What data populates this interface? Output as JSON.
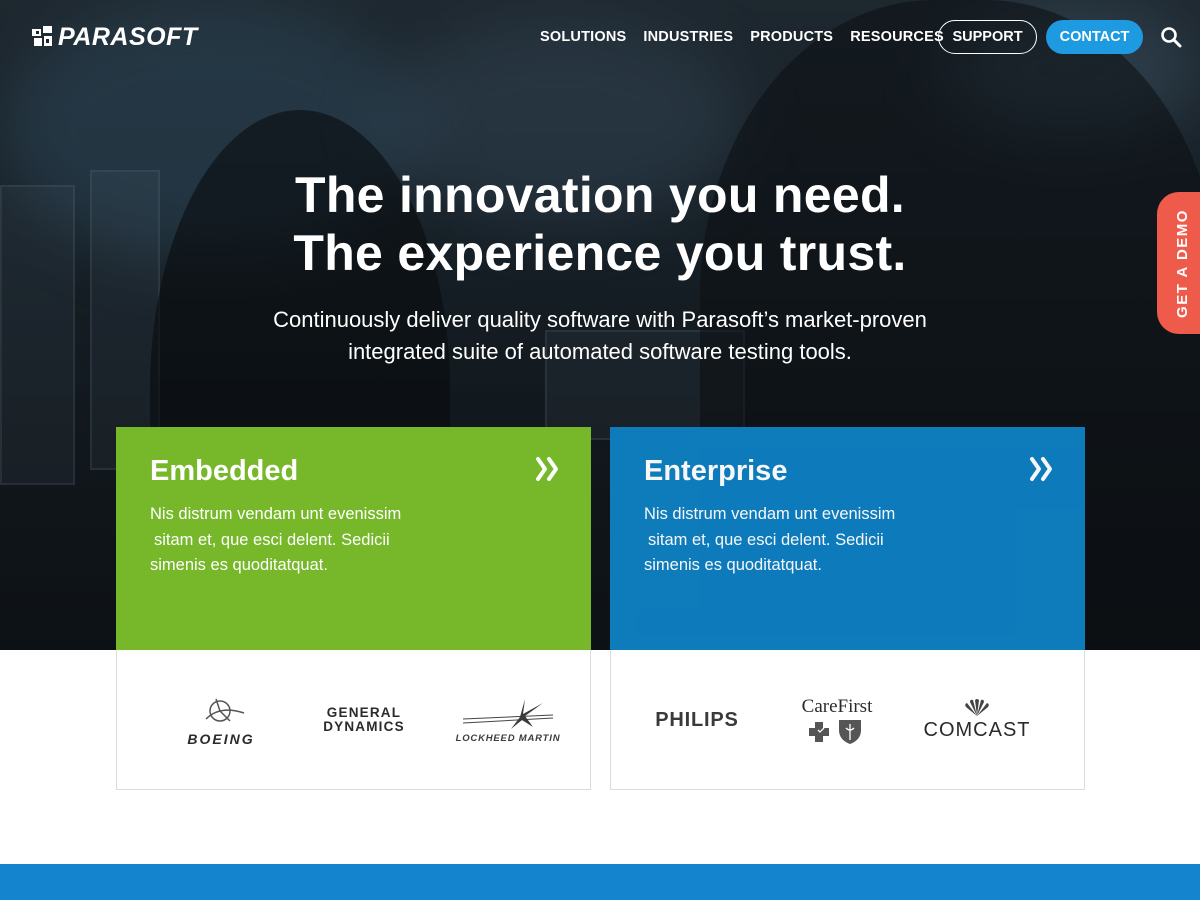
{
  "brand": {
    "name": "PARASOFT",
    "accent": "#1e9ae0"
  },
  "nav": {
    "items": [
      "SOLUTIONS",
      "INDUSTRIES",
      "PRODUCTS",
      "RESOURCES"
    ]
  },
  "header": {
    "support_label": "SUPPORT",
    "contact_label": "CONTACT",
    "search_icon": "search-icon"
  },
  "hero": {
    "headline_line1": "The innovation you need.",
    "headline_line2": "The experience you trust.",
    "subhead_line1": "Continuously deliver quality software with Parasoft’s market-proven",
    "subhead_line2": "integrated suite of automated software testing tools."
  },
  "demo_tab": {
    "label": "GET A DEMO",
    "color": "#ef5b4b"
  },
  "cards": [
    {
      "title": "Embedded",
      "color": "#76b82a",
      "desc_lines": [
        "Nis distrum vendam unt evenissim",
        "sitam et, que esci delent. Sedicii",
        "simenis es quoditatquat."
      ],
      "logos": [
        "BOEING",
        "GENERAL",
        "DYNAMICS",
        "LOCKHEED MARTIN"
      ]
    },
    {
      "title": "Enterprise",
      "color": "#0e7fc1",
      "desc_lines": [
        "Nis distrum vendam unt evenissim",
        "sitam et, que esci delent. Sedicii",
        "simenis es quoditatquat."
      ],
      "logos": [
        "PHILIPS",
        "CareFirst",
        "COMCAST"
      ]
    }
  ],
  "footer_band": {
    "color": "#1584ce"
  }
}
